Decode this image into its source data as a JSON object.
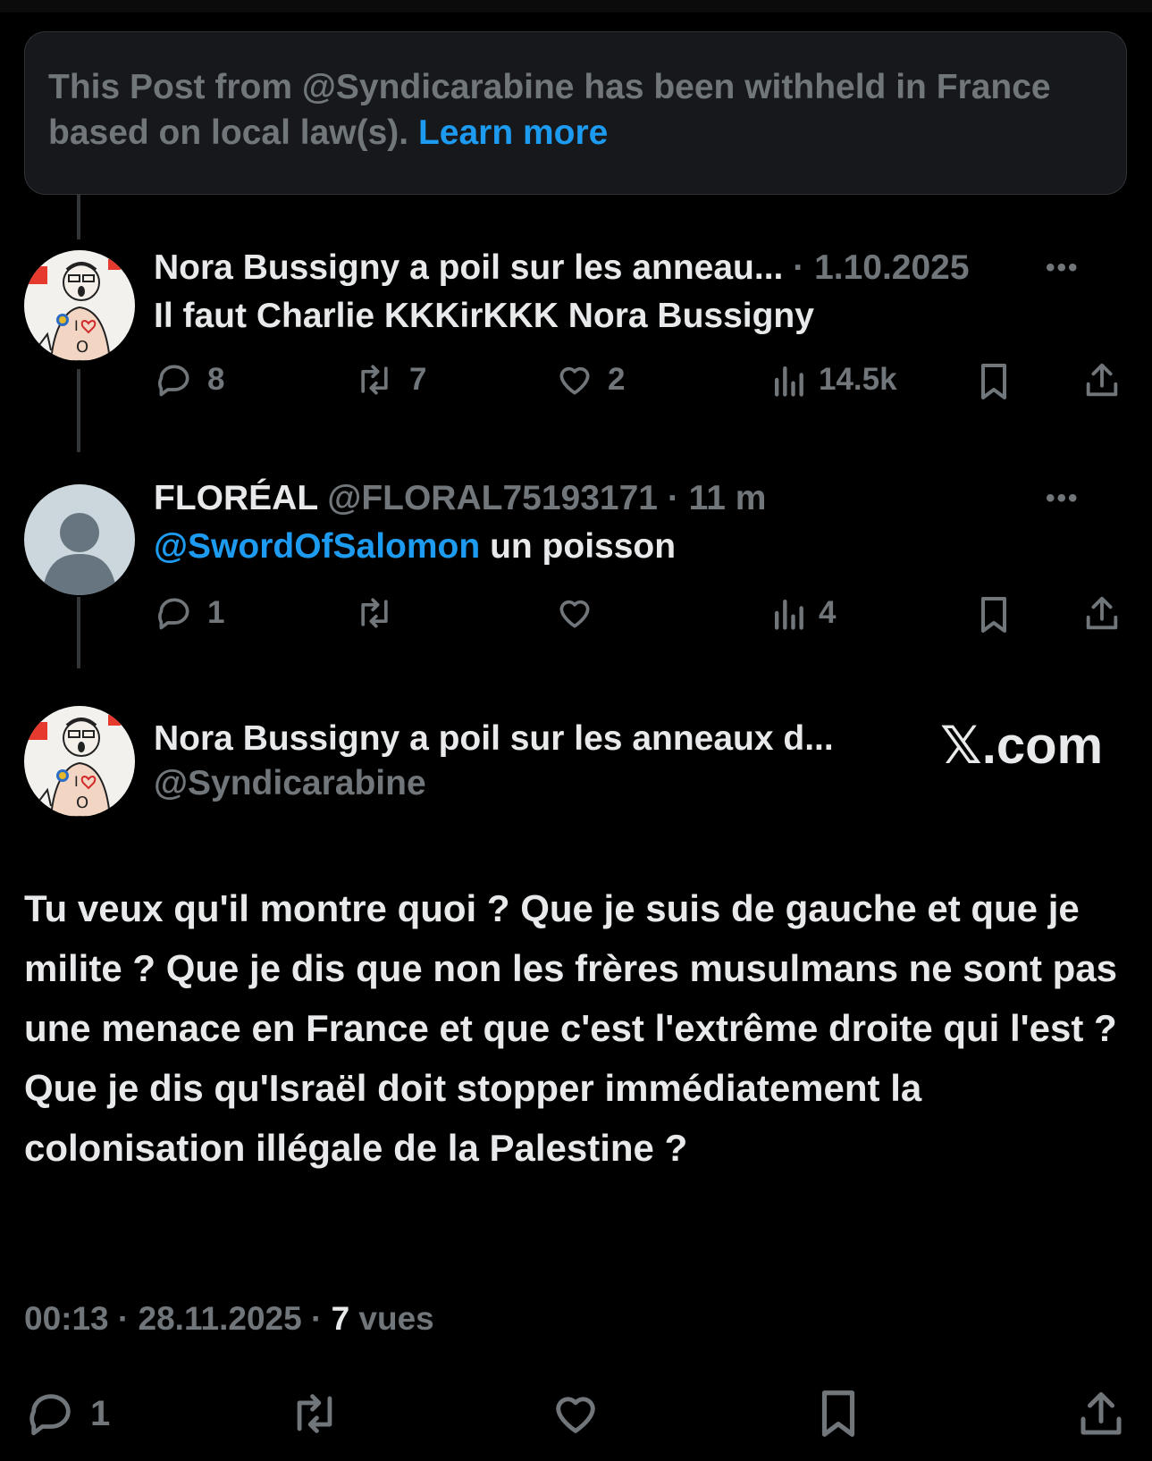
{
  "notice": {
    "text": "This Post from @Syndicarabine has been withheld in France based on local law(s).",
    "link": "Learn more"
  },
  "reply1": {
    "display_name": "Nora Bussigny a poil sur les anneau...",
    "separator": "·",
    "date": "1.10.2025",
    "text": "Il faut Charlie KKKirKKK Nora Bussigny",
    "replies": "8",
    "reposts": "7",
    "likes": "2",
    "views": "14.5k"
  },
  "reply2": {
    "display_name": "FLORÉAL",
    "handle": "@FLORAL75193171",
    "separator": "·",
    "time": "11 m",
    "mention": "@SwordOfSalomon",
    "text": "un poisson",
    "replies": "1",
    "reposts": "",
    "likes": "",
    "views": "4"
  },
  "main_post": {
    "display_name": "Nora Bussigny a poil sur les anneaux d...",
    "handle": "@Syndicarabine",
    "watermark": "𝕏.com",
    "text": "Tu veux qu'il montre quoi ? Que je suis de gauche et que je milite ? Que je dis que non les frères musulmans ne sont pas une menace en France et que c'est l'extrême droite qui l'est ? Que je dis qu'Israël doit stopper immédiatement la colonisation illégale de la Palestine ?",
    "time": "00:13",
    "date": "28.11.2025",
    "views_count": "7",
    "views_label": "vues",
    "replies": "1"
  },
  "icons": {
    "reply": "reply-icon",
    "repost": "repost-icon",
    "like": "heart-icon",
    "views": "views-icon",
    "bookmark": "bookmark-icon",
    "share": "share-icon",
    "more": "more-icon"
  },
  "colors": {
    "background": "#000000",
    "text": "#e7e9ea",
    "muted": "#71767b",
    "link": "#1d9bf0",
    "notice_bg": "#16181c"
  }
}
